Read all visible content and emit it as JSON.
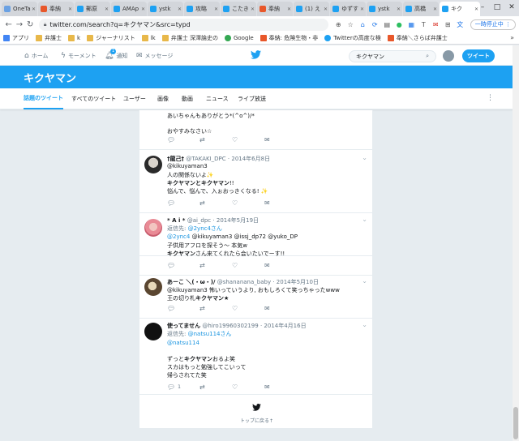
{
  "browser": {
    "tabs": [
      {
        "label": "OneTa",
        "color": "#6aa1e3"
      },
      {
        "label": "奉納",
        "color": "#e8572a"
      },
      {
        "label": "郵原",
        "color": "#1da1f2"
      },
      {
        "label": "AMAp",
        "color": "#1da1f2"
      },
      {
        "label": "ystk",
        "color": "#1da1f2"
      },
      {
        "label": "攻略",
        "color": "#1da1f2"
      },
      {
        "label": "こたき",
        "color": "#1da1f2"
      },
      {
        "label": "奉納",
        "color": "#e8572a"
      },
      {
        "label": "(1) え",
        "color": "#1da1f2"
      },
      {
        "label": "ゆずす",
        "color": "#1da1f2"
      },
      {
        "label": "ystk",
        "color": "#1da1f2"
      },
      {
        "label": "高橋",
        "color": "#1da1f2"
      },
      {
        "label": "キク",
        "color": "#1da1f2"
      }
    ],
    "url": "twitter.com/search?q=キクヤマン&src=typd",
    "pause_label": "一時停止中",
    "bookmarks": [
      {
        "label": "アプリ",
        "color": "#4285f4"
      },
      {
        "label": "弁護士",
        "color": "#e8b84a"
      },
      {
        "label": "k",
        "color": "#e8b84a"
      },
      {
        "label": "ジャーナリスト",
        "color": "#e8b84a"
      },
      {
        "label": "lk",
        "color": "#e8b84a"
      },
      {
        "label": "弁護士 深澤論史の",
        "color": "#e8b84a"
      },
      {
        "label": "Google",
        "color": "#34a853"
      },
      {
        "label": "奉納: 危険生物・非",
        "color": "#e8572a"
      },
      {
        "label": "Twitterの高度な検",
        "color": "#1da1f2"
      },
      {
        "label": "奉納＼さらば弁護士",
        "color": "#e8572a"
      }
    ]
  },
  "twitter_nav": {
    "home": "ホーム",
    "moments": "モーメント",
    "notifications": "通知",
    "notif_count": "1",
    "messages": "メッセージ",
    "search_value": "キクヤマン",
    "tweet_button": "ツイート"
  },
  "search": {
    "title": "キクヤマン",
    "tabs": [
      "話題のツイート",
      "すべてのツイート",
      "ユーザー",
      "画像",
      "動画",
      "ニュース",
      "ライブ放送"
    ]
  },
  "tweets": [
    {
      "lines": [
        "あいちゃんもありがとう*(^o^)/*",
        "おやすみなさい☆"
      ]
    },
    {
      "name": "†龍己†",
      "handle": "@TAKAKI_DPC",
      "date": "2014年6月8日",
      "l1": "@kikuyaman3",
      "l2": "人の関係ないよ✨",
      "l3a": "キクヤマン",
      "l3b": "とキクヤマン",
      "l3c": "!!",
      "l4": "悩んで、悩んで、入ぉおっきくなる! ✨"
    },
    {
      "name": "* A i *",
      "handle": "@ai_dpc",
      "date": "2014年5月19日",
      "reply_to_prefix": "返信先:",
      "reply_to": "@2ync4さん",
      "l1a": "@2ync4",
      "l1b": "@kikuyaman3 @issj_dp72 @yuko_DP",
      "l2": "子供用アフロを探そう～ 本気w",
      "l3a": "キクヤマン",
      "l3b": "さん来てくれたら会いたいでーす!!"
    },
    {
      "name": "あーこ ＼(・ω・)/",
      "handle": "@shananana_baby",
      "date": "2014年5月10日",
      "l1": "@kikuyaman3 怖いっていうより, おもしろくて笑っちゃったwww",
      "l2a": "王の切り札",
      "l2b": "キクヤマン",
      "l2c": "★"
    },
    {
      "name": "使ってません",
      "handle": "@hiro19960302199",
      "date": "2014年4月16日",
      "reply_to_prefix": "返信先:",
      "reply_to": "@natsu114さん",
      "l1": "@natsu114",
      "l2a": "ずっと",
      "l2b": "キクヤマン",
      "l2c": "おるよ笑",
      "l3": "スカはもっと勉強してこいって",
      "l4": "帰らされてた笑",
      "reply_count": "1"
    }
  ],
  "footer": {
    "back_to_top": "トップに戻る↑"
  }
}
